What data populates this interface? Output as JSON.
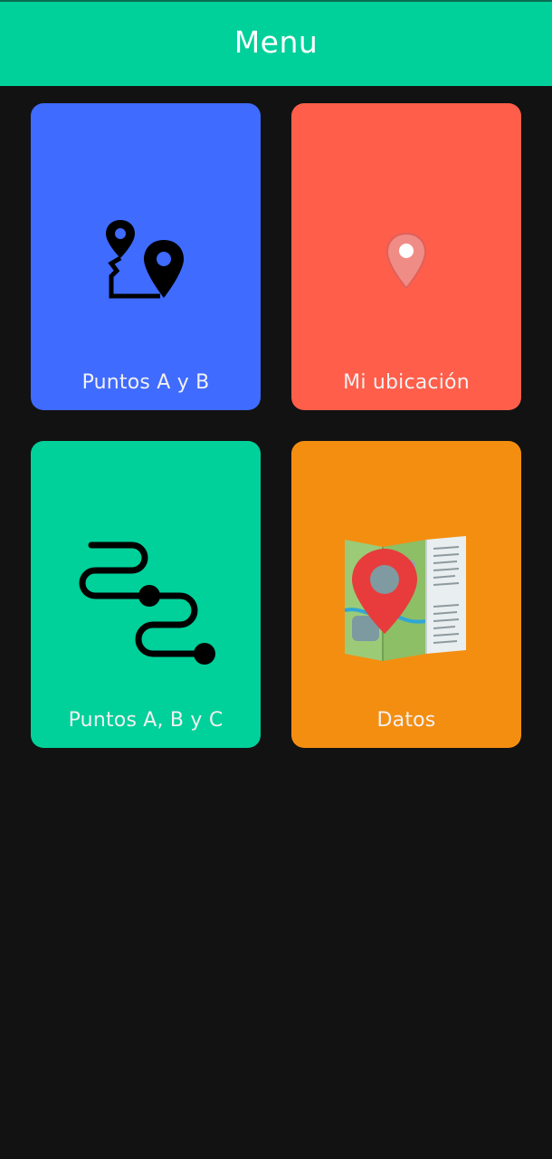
{
  "header": {
    "title": "Menu",
    "color": "#00D09A"
  },
  "menu": {
    "items": [
      {
        "label": "Puntos A y B",
        "icon": "route-pins-icon",
        "color": "#3F6BFF"
      },
      {
        "label": "Mi ubicación",
        "icon": "location-pin-icon",
        "color": "#FF5E4A"
      },
      {
        "label": "Puntos A, B y C",
        "icon": "winding-path-icon",
        "color": "#00D09A"
      },
      {
        "label": "Datos",
        "icon": "folded-map-icon",
        "color": "#F48E11"
      }
    ]
  },
  "background": "#121212"
}
